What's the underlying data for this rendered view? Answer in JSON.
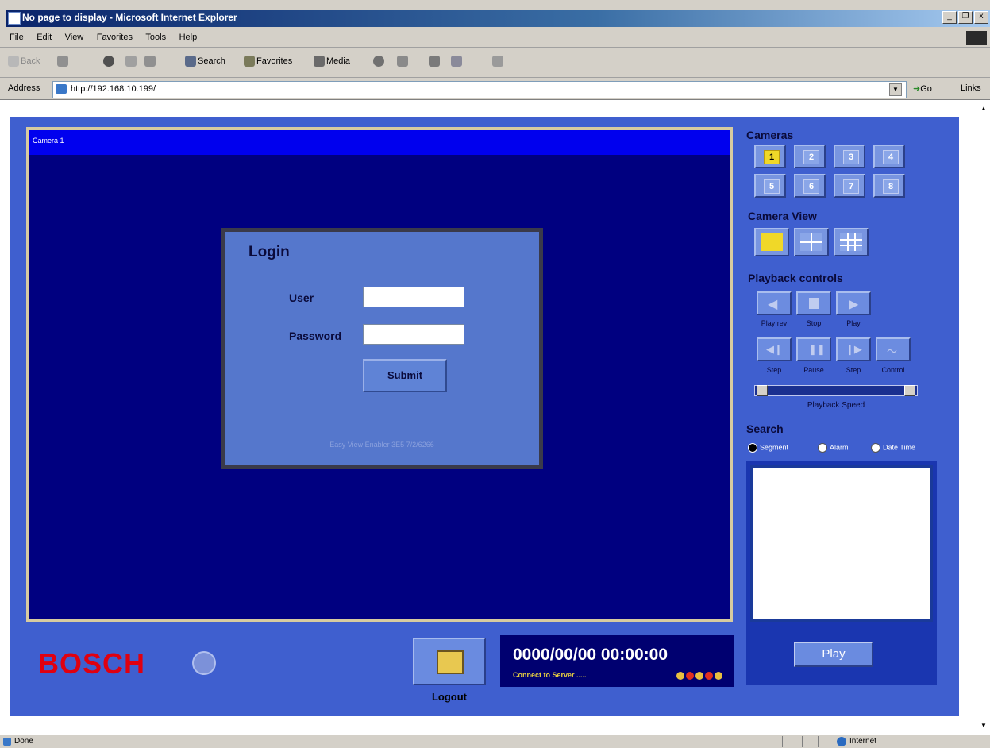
{
  "window": {
    "title": "No page to display - Microsoft Internet Explorer",
    "controls": [
      "_",
      "❐",
      "x"
    ]
  },
  "menu": [
    "File",
    "Edit",
    "View",
    "Favorites",
    "Tools",
    "Help"
  ],
  "toolbar": {
    "back": "Back",
    "search": "Search",
    "favorites": "Favorites",
    "media": "Media"
  },
  "address": {
    "label": "Address",
    "url": "http://192.168.10.199/",
    "go": "Go",
    "links": "Links"
  },
  "camera": {
    "header": "Camera 1"
  },
  "login": {
    "title": "Login",
    "user_label": "User",
    "user_value": "",
    "password_label": "Password",
    "password_value": "",
    "submit": "Submit",
    "footer": "Easy View Enabler 3E5 7/2/6266"
  },
  "bottom": {
    "brand": "BOSCH",
    "logout": "Logout",
    "datetime": "0000/00/00 00:00:00",
    "status": "Connect to Server ....."
  },
  "panel": {
    "cameras_title": "Cameras",
    "cameras": [
      "1",
      "2",
      "3",
      "4",
      "5",
      "6",
      "7",
      "8"
    ],
    "selected_camera": "1",
    "camera_view_title": "Camera View",
    "playback_title": "Playback controls",
    "pb_row1": [
      "Play rev",
      "Stop",
      "Play"
    ],
    "pb_row2": [
      "Step",
      "Pause",
      "Step",
      "Control"
    ],
    "speed_label": "Playback Speed",
    "search_title": "Search",
    "search_options": [
      "Segment",
      "Alarm",
      "Date Time"
    ],
    "search_selected": "Segment",
    "play": "Play"
  },
  "status": {
    "left": "Done",
    "zone": "Internet"
  },
  "colors": {
    "app_bg": "#3f5fcf",
    "video_bg": "#000080",
    "brand_red": "#e00010",
    "accent_yellow": "#f0d828"
  }
}
